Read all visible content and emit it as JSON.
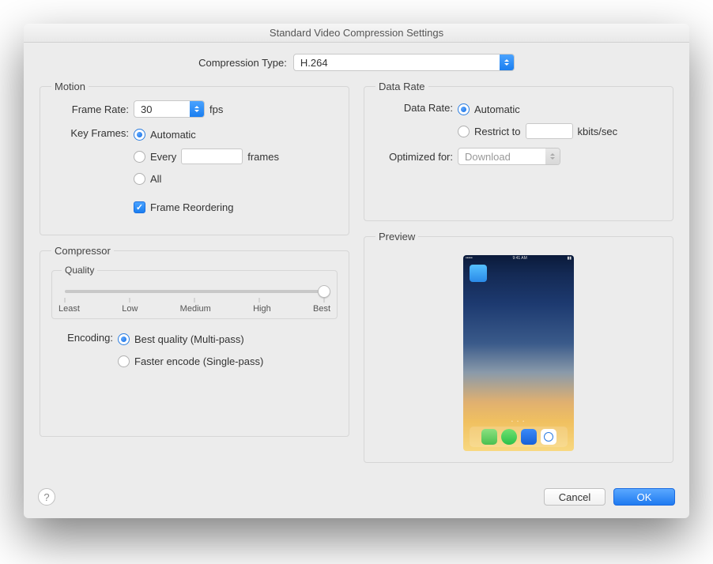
{
  "window": {
    "title": "Standard Video Compression Settings"
  },
  "compression": {
    "label": "Compression Type:",
    "value": "H.264"
  },
  "motion": {
    "legend": "Motion",
    "frame_rate": {
      "label": "Frame Rate:",
      "value": "30",
      "units": "fps"
    },
    "key_frames": {
      "label": "Key Frames:",
      "options": {
        "automatic": "Automatic",
        "every": "Every",
        "every_units": "frames",
        "all": "All"
      },
      "selected": "automatic"
    },
    "frame_reordering": {
      "label": "Frame Reordering",
      "checked": true
    }
  },
  "data_rate": {
    "legend": "Data Rate",
    "label": "Data Rate:",
    "options": {
      "automatic": "Automatic",
      "restrict": "Restrict to"
    },
    "restrict_units": "kbits/sec",
    "selected": "automatic",
    "optimized": {
      "label": "Optimized for:",
      "value": "Download"
    }
  },
  "compressor": {
    "legend": "Compressor",
    "quality": {
      "legend": "Quality",
      "ticks": [
        "Least",
        "Low",
        "Medium",
        "High",
        "Best"
      ],
      "value_pct": 100
    },
    "encoding": {
      "label": "Encoding:",
      "options": {
        "best": "Best quality (Multi-pass)",
        "faster": "Faster encode (Single-pass)"
      },
      "selected": "best"
    }
  },
  "preview": {
    "legend": "Preview",
    "status_time": "9:41 AM"
  },
  "footer": {
    "help": "?",
    "cancel": "Cancel",
    "ok": "OK"
  }
}
